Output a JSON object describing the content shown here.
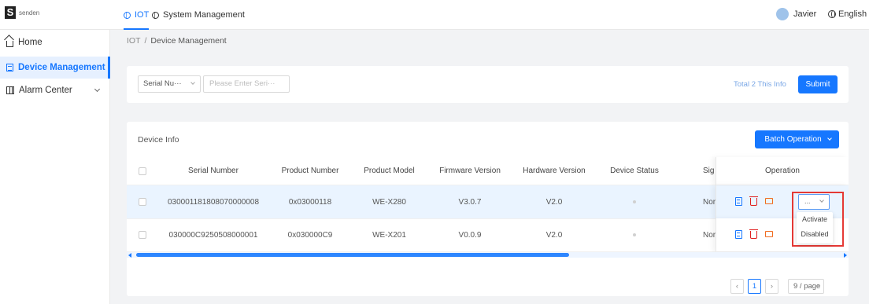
{
  "app": {
    "logo_letter": "S",
    "logo_text": "senden"
  },
  "topnav": {
    "tabs": [
      {
        "label": "IOT",
        "active": true
      },
      {
        "label": "System Management",
        "active": false
      }
    ],
    "user_name": "Javier",
    "language": "English"
  },
  "sidebar": {
    "items": [
      {
        "label": "Home",
        "icon": "home-icon",
        "active": false
      },
      {
        "label": "Device Management",
        "icon": "list-icon",
        "active": true
      },
      {
        "label": "Alarm Center",
        "icon": "grid-icon",
        "active": false,
        "expandable": true
      }
    ]
  },
  "breadcrumb": {
    "root": "IOT",
    "separator": "/",
    "current": "Device Management"
  },
  "filter": {
    "select_value": "Serial Nu···",
    "input_placeholder": "Please Enter Seri···",
    "total_text": "Total 2 This Info",
    "submit_label": "Submit"
  },
  "table": {
    "title": "Device Info",
    "batch_label": "Batch Operation",
    "columns": [
      "Serial Number",
      "Product Number",
      "Product Model",
      "Firmware Version",
      "Hardware Version",
      "Device Status",
      "Sig",
      "Operation"
    ],
    "rows": [
      {
        "serial": "030001181808070000008",
        "product_number": "0x03000118",
        "model": "WE-X280",
        "firmware": "V3.0.7",
        "hardware": "V2.0",
        "signal": "Nor"
      },
      {
        "serial": "030000C9250508000001",
        "product_number": "0x030000C9",
        "model": "WE-X201",
        "firmware": "V0.0.9",
        "hardware": "V2.0",
        "signal": "Nor"
      }
    ],
    "more_select": "...",
    "dropdown_options": [
      "Activate",
      "Disabled"
    ]
  },
  "pagination": {
    "current_page": "1",
    "page_size": "9 / page"
  },
  "colors": {
    "accent": "#1677ff",
    "danger": "#e02020",
    "warning": "#f06b1f",
    "highlight_border": "#e53935"
  }
}
